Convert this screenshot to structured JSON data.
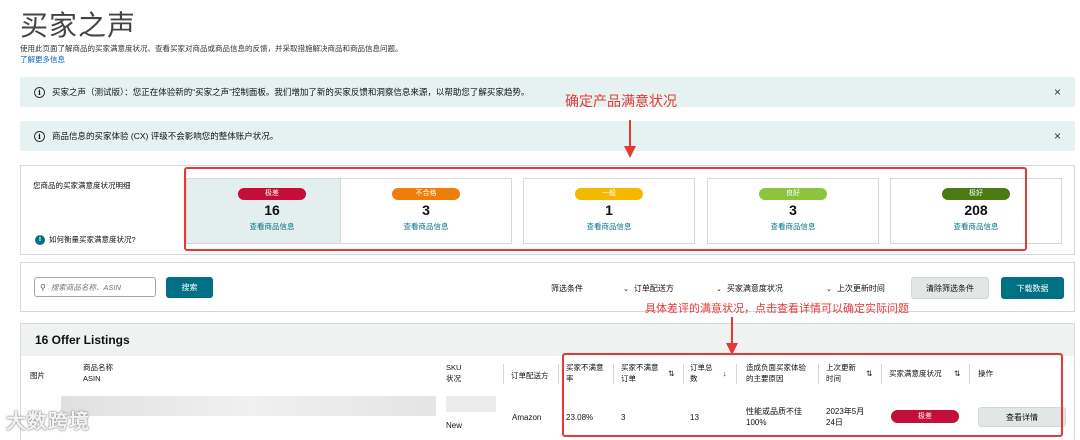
{
  "page": {
    "title": "买家之声",
    "description": "使用此页面了解商品的买家满意度状况、查看买家对商品或商品信息的反馈，并采取措施解决商品和商品信息问题。",
    "learn_more": "了解更多信息"
  },
  "alerts": [
    {
      "text": "买家之声（测试版）：您正在体验新的“买家之声”控制面板。我们增加了新的买家反馈和洞察信息来源，以帮助您了解买家趋势。",
      "close_icon": "×"
    },
    {
      "text": "商品信息的买家体验 (CX) 评级不会影响您的整体账户状况。",
      "close_icon": "×"
    }
  ],
  "satisfaction": {
    "label": "您商品的买家满意度状况明细",
    "help_text": "如何衡量买家满意度状况?",
    "cards": [
      {
        "status": "极差",
        "count": "16",
        "link": "查看商品信息",
        "color": "#c40e3a",
        "selected": true
      },
      {
        "status": "不合格",
        "count": "3",
        "link": "查看商品信息",
        "color": "#f07d0a",
        "selected": false
      },
      {
        "status": "一般",
        "count": "1",
        "link": "查看商品信息",
        "color": "#f5b800",
        "selected": false
      },
      {
        "status": "良好",
        "count": "3",
        "link": "查看商品信息",
        "color": "#8cc43f",
        "selected": false
      },
      {
        "status": "极好",
        "count": "208",
        "link": "查看商品信息",
        "color": "#4b7a12",
        "selected": false
      }
    ]
  },
  "filters": {
    "search_placeholder": "搜索商品名称、ASIN",
    "search_button": "搜索",
    "filter_label": "筛选条件",
    "dropdowns": [
      "订单配送方",
      "买家满意度状况",
      "上次更新时间"
    ],
    "clear_button": "清除筛选条件",
    "download_button": "下载数据"
  },
  "table": {
    "title": "16 Offer Listings",
    "headers": {
      "image": "图片",
      "name": "商品名称",
      "asin": "ASIN",
      "sku": "SKU",
      "sku_status": "状况",
      "fulfillment": "订单配送方",
      "rate_1": "买家不满意",
      "rate_2": "率",
      "unsat_1": "买家不满意",
      "unsat_2": "订单",
      "total_1": "订单总",
      "total_2": "数",
      "reason_1": "造成负面买家体验",
      "reason_2": "的主要原因",
      "updated_1": "上次更新",
      "updated_2": "时间",
      "status": "买家满意度状况",
      "action": "操作"
    },
    "row": {
      "sku_status": "New",
      "fulfillment": "Amazon",
      "rate": "23.08%",
      "unsat_orders": "3",
      "total_orders": "13",
      "reason_1": "性能或品质不佳",
      "reason_2": "100%",
      "updated_1": "2023年5月",
      "updated_2": "24日",
      "status": "极差",
      "action": "查看详情"
    }
  },
  "annotations": {
    "top": "确定产品满意状况",
    "bottom": "具体差评的满意状况，点击查看详情可以确定实际问题"
  },
  "watermark": "大数跨境"
}
